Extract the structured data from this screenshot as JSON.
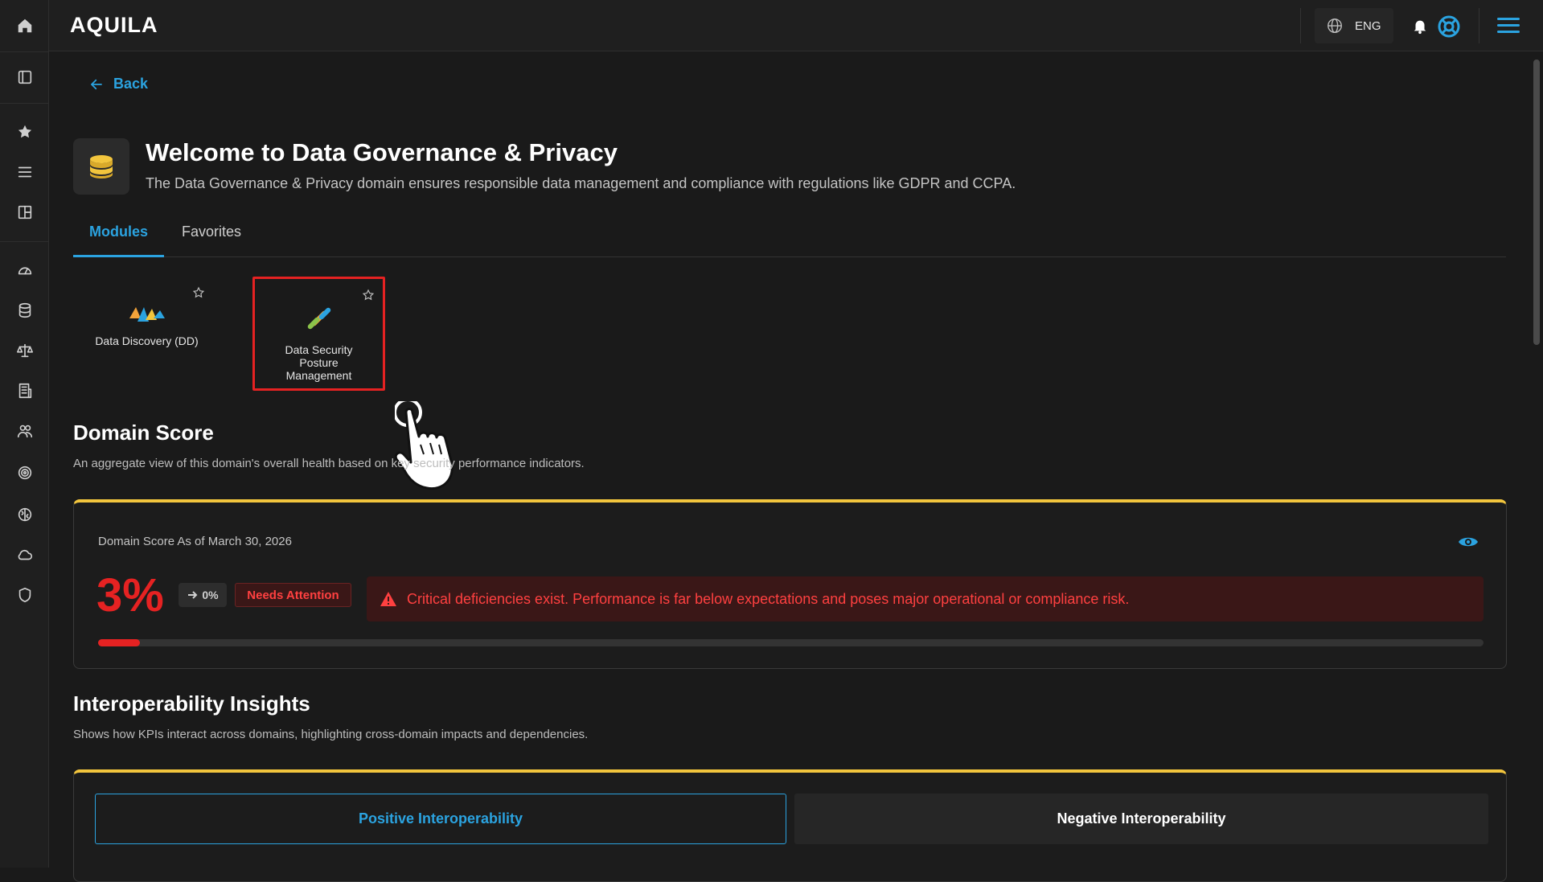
{
  "app": {
    "logo": "AQUILA"
  },
  "topbar": {
    "language": "ENG"
  },
  "sidebar": {
    "icons": [
      "home-icon",
      "panel-icon",
      "star-icon",
      "menu-icon",
      "layout-icon",
      "gauge-icon",
      "database-icon",
      "scale-icon",
      "building-icon",
      "users-icon",
      "target-icon",
      "brain-icon",
      "cloud-icon",
      "shield-icon"
    ]
  },
  "page": {
    "back_label": "Back",
    "title": "Welcome to Data Governance & Privacy",
    "subtitle": "The Data Governance & Privacy domain ensures responsible data management and compliance with regulations like GDPR and CCPA."
  },
  "tabs": [
    {
      "label": "Modules",
      "active": true
    },
    {
      "label": "Favorites",
      "active": false
    }
  ],
  "modules": [
    {
      "label": "Data Discovery (DD)"
    },
    {
      "label_lines": [
        "Data Security",
        "Posture",
        "Management"
      ]
    }
  ],
  "domain_score": {
    "title": "Domain Score",
    "description": "An aggregate view of this domain's overall health based on key security performance indicators.",
    "as_of": "Domain Score As of March 30, 2026",
    "score": "3%",
    "score_value": 3,
    "delta": "0%",
    "status": "Needs Attention",
    "alert": "Critical deficiencies exist. Performance is far below expectations and poses major operational or compliance risk.",
    "colors": {
      "critical": "#e52222",
      "accent": "#f2c53d"
    }
  },
  "interoperability": {
    "title": "Interoperability Insights",
    "description": "Shows how KPIs interact across domains, highlighting cross-domain impacts and dependencies.",
    "positive_label": "Positive Interoperability",
    "negative_label": "Negative Interoperability"
  },
  "colors": {
    "primary": "#2ba3e0",
    "background": "#1a1a1a"
  }
}
